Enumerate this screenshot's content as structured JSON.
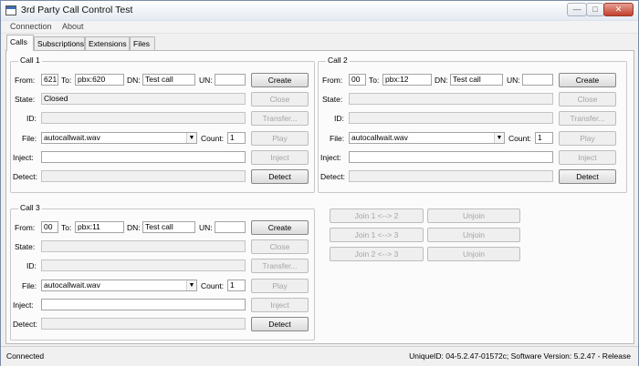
{
  "window": {
    "title": "3rd Party Call Control Test",
    "controls": {
      "minimize": "—",
      "maximize": "□",
      "close": "✕"
    }
  },
  "menu": [
    {
      "label": "Connection"
    },
    {
      "label": "About"
    }
  ],
  "tabs": [
    {
      "label": "Calls",
      "active": true
    },
    {
      "label": "Subscriptions"
    },
    {
      "label": "Extensions"
    },
    {
      "label": "Files"
    }
  ],
  "labels": {
    "from": "From:",
    "to": "To:",
    "dn": "DN:",
    "un": "UN:",
    "state": "State:",
    "id": "ID:",
    "file": "File:",
    "count": "Count:",
    "inject": "Inject:",
    "detect": "Detect:"
  },
  "buttons": {
    "create": "Create",
    "close": "Close",
    "transfer": "Transfer...",
    "play": "Play",
    "inject": "Inject",
    "detect": "Detect"
  },
  "calls": [
    {
      "title": "Call 1",
      "from": "621",
      "to": "pbx:620",
      "dn": "Test call",
      "un": "",
      "state": "Closed",
      "id": "",
      "file": "autocallwait.wav",
      "count": "1",
      "inject": "",
      "detect": ""
    },
    {
      "title": "Call 2",
      "from": "00",
      "to": "pbx:12",
      "dn": "Test call",
      "un": "",
      "state": "",
      "id": "",
      "file": "autocallwait.wav",
      "count": "1",
      "inject": "",
      "detect": ""
    },
    {
      "title": "Call 3",
      "from": "00",
      "to": "pbx:11",
      "dn": "Test call",
      "un": "",
      "state": "",
      "id": "",
      "file": "autocallwait.wav",
      "count": "1",
      "inject": "",
      "detect": ""
    }
  ],
  "joins": [
    {
      "join": "Join 1 <--> 2",
      "unjoin": "Unjoin"
    },
    {
      "join": "Join 1 <--> 3",
      "unjoin": "Unjoin"
    },
    {
      "join": "Join 2 <--> 3",
      "unjoin": "Unjoin"
    }
  ],
  "status": {
    "connection": "Connected",
    "info": "UniqueID: 04-5.2.47-01572c; Software Version: 5.2.47 - Release"
  }
}
